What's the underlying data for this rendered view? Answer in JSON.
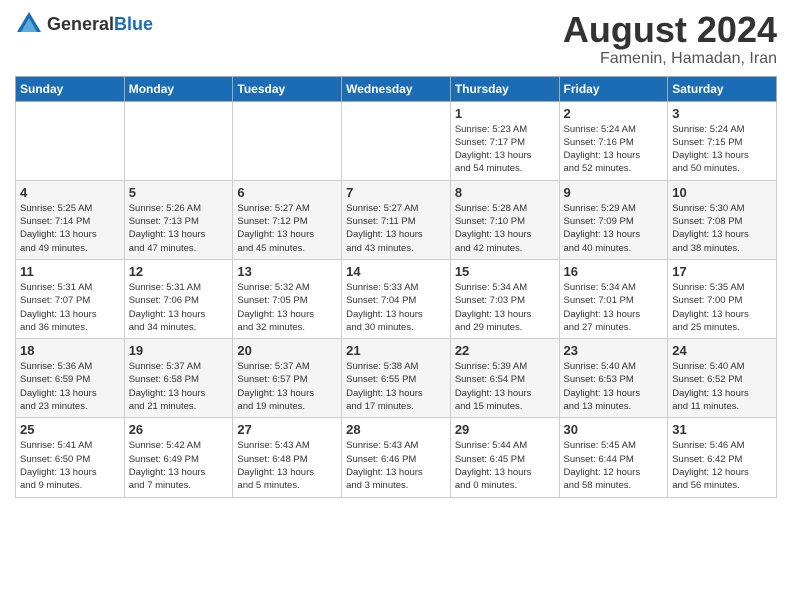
{
  "header": {
    "logo_general": "General",
    "logo_blue": "Blue",
    "title": "August 2024",
    "subtitle": "Famenin, Hamadan, Iran"
  },
  "weekdays": [
    "Sunday",
    "Monday",
    "Tuesday",
    "Wednesday",
    "Thursday",
    "Friday",
    "Saturday"
  ],
  "weeks": [
    [
      {
        "day": "",
        "detail": ""
      },
      {
        "day": "",
        "detail": ""
      },
      {
        "day": "",
        "detail": ""
      },
      {
        "day": "",
        "detail": ""
      },
      {
        "day": "1",
        "detail": "Sunrise: 5:23 AM\nSunset: 7:17 PM\nDaylight: 13 hours\nand 54 minutes."
      },
      {
        "day": "2",
        "detail": "Sunrise: 5:24 AM\nSunset: 7:16 PM\nDaylight: 13 hours\nand 52 minutes."
      },
      {
        "day": "3",
        "detail": "Sunrise: 5:24 AM\nSunset: 7:15 PM\nDaylight: 13 hours\nand 50 minutes."
      }
    ],
    [
      {
        "day": "4",
        "detail": "Sunrise: 5:25 AM\nSunset: 7:14 PM\nDaylight: 13 hours\nand 49 minutes."
      },
      {
        "day": "5",
        "detail": "Sunrise: 5:26 AM\nSunset: 7:13 PM\nDaylight: 13 hours\nand 47 minutes."
      },
      {
        "day": "6",
        "detail": "Sunrise: 5:27 AM\nSunset: 7:12 PM\nDaylight: 13 hours\nand 45 minutes."
      },
      {
        "day": "7",
        "detail": "Sunrise: 5:27 AM\nSunset: 7:11 PM\nDaylight: 13 hours\nand 43 minutes."
      },
      {
        "day": "8",
        "detail": "Sunrise: 5:28 AM\nSunset: 7:10 PM\nDaylight: 13 hours\nand 42 minutes."
      },
      {
        "day": "9",
        "detail": "Sunrise: 5:29 AM\nSunset: 7:09 PM\nDaylight: 13 hours\nand 40 minutes."
      },
      {
        "day": "10",
        "detail": "Sunrise: 5:30 AM\nSunset: 7:08 PM\nDaylight: 13 hours\nand 38 minutes."
      }
    ],
    [
      {
        "day": "11",
        "detail": "Sunrise: 5:31 AM\nSunset: 7:07 PM\nDaylight: 13 hours\nand 36 minutes."
      },
      {
        "day": "12",
        "detail": "Sunrise: 5:31 AM\nSunset: 7:06 PM\nDaylight: 13 hours\nand 34 minutes."
      },
      {
        "day": "13",
        "detail": "Sunrise: 5:32 AM\nSunset: 7:05 PM\nDaylight: 13 hours\nand 32 minutes."
      },
      {
        "day": "14",
        "detail": "Sunrise: 5:33 AM\nSunset: 7:04 PM\nDaylight: 13 hours\nand 30 minutes."
      },
      {
        "day": "15",
        "detail": "Sunrise: 5:34 AM\nSunset: 7:03 PM\nDaylight: 13 hours\nand 29 minutes."
      },
      {
        "day": "16",
        "detail": "Sunrise: 5:34 AM\nSunset: 7:01 PM\nDaylight: 13 hours\nand 27 minutes."
      },
      {
        "day": "17",
        "detail": "Sunrise: 5:35 AM\nSunset: 7:00 PM\nDaylight: 13 hours\nand 25 minutes."
      }
    ],
    [
      {
        "day": "18",
        "detail": "Sunrise: 5:36 AM\nSunset: 6:59 PM\nDaylight: 13 hours\nand 23 minutes."
      },
      {
        "day": "19",
        "detail": "Sunrise: 5:37 AM\nSunset: 6:58 PM\nDaylight: 13 hours\nand 21 minutes."
      },
      {
        "day": "20",
        "detail": "Sunrise: 5:37 AM\nSunset: 6:57 PM\nDaylight: 13 hours\nand 19 minutes."
      },
      {
        "day": "21",
        "detail": "Sunrise: 5:38 AM\nSunset: 6:55 PM\nDaylight: 13 hours\nand 17 minutes."
      },
      {
        "day": "22",
        "detail": "Sunrise: 5:39 AM\nSunset: 6:54 PM\nDaylight: 13 hours\nand 15 minutes."
      },
      {
        "day": "23",
        "detail": "Sunrise: 5:40 AM\nSunset: 6:53 PM\nDaylight: 13 hours\nand 13 minutes."
      },
      {
        "day": "24",
        "detail": "Sunrise: 5:40 AM\nSunset: 6:52 PM\nDaylight: 13 hours\nand 11 minutes."
      }
    ],
    [
      {
        "day": "25",
        "detail": "Sunrise: 5:41 AM\nSunset: 6:50 PM\nDaylight: 13 hours\nand 9 minutes."
      },
      {
        "day": "26",
        "detail": "Sunrise: 5:42 AM\nSunset: 6:49 PM\nDaylight: 13 hours\nand 7 minutes."
      },
      {
        "day": "27",
        "detail": "Sunrise: 5:43 AM\nSunset: 6:48 PM\nDaylight: 13 hours\nand 5 minutes."
      },
      {
        "day": "28",
        "detail": "Sunrise: 5:43 AM\nSunset: 6:46 PM\nDaylight: 13 hours\nand 3 minutes."
      },
      {
        "day": "29",
        "detail": "Sunrise: 5:44 AM\nSunset: 6:45 PM\nDaylight: 13 hours\nand 0 minutes."
      },
      {
        "day": "30",
        "detail": "Sunrise: 5:45 AM\nSunset: 6:44 PM\nDaylight: 12 hours\nand 58 minutes."
      },
      {
        "day": "31",
        "detail": "Sunrise: 5:46 AM\nSunset: 6:42 PM\nDaylight: 12 hours\nand 56 minutes."
      }
    ]
  ]
}
